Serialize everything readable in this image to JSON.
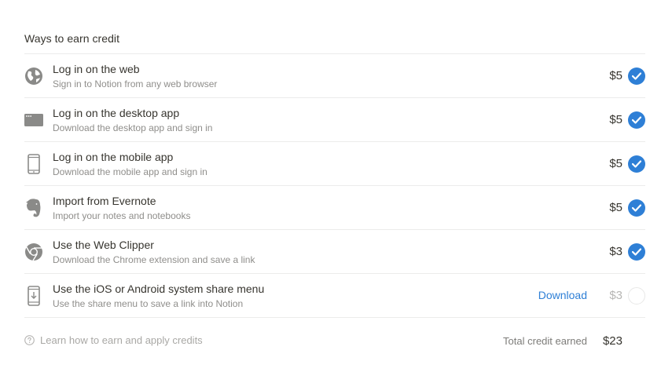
{
  "section_title": "Ways to earn credit",
  "colors": {
    "accent": "#2e7fd6",
    "text": "#37352f",
    "muted_text": "#8f8e8b",
    "divider": "#ececeb",
    "icon_gray": "#8a8a88"
  },
  "items": [
    {
      "icon": "globe-icon",
      "title": "Log in on the web",
      "description": "Sign in to Notion from any web browser",
      "amount": "$5",
      "completed": true
    },
    {
      "icon": "desktop-window-icon",
      "title": "Log in on the desktop app",
      "description": "Download the desktop app and sign in",
      "amount": "$5",
      "completed": true
    },
    {
      "icon": "mobile-phone-icon",
      "title": "Log in on the mobile app",
      "description": "Download the mobile app and sign in",
      "amount": "$5",
      "completed": true
    },
    {
      "icon": "evernote-elephant-icon",
      "title": "Import from Evernote",
      "description": "Import your notes and notebooks",
      "amount": "$5",
      "completed": true
    },
    {
      "icon": "chrome-icon",
      "title": "Use the Web Clipper",
      "description": "Download the Chrome extension and save a link",
      "amount": "$3",
      "completed": true
    },
    {
      "icon": "share-menu-phone-icon",
      "title": "Use the iOS or Android system share menu",
      "description": "Use the share menu to save a link into Notion",
      "amount": "$3",
      "completed": false,
      "action_label": "Download"
    }
  ],
  "footer": {
    "help_link": "Learn how to earn and apply credits",
    "total_label": "Total credit earned",
    "total_value": "$23"
  }
}
